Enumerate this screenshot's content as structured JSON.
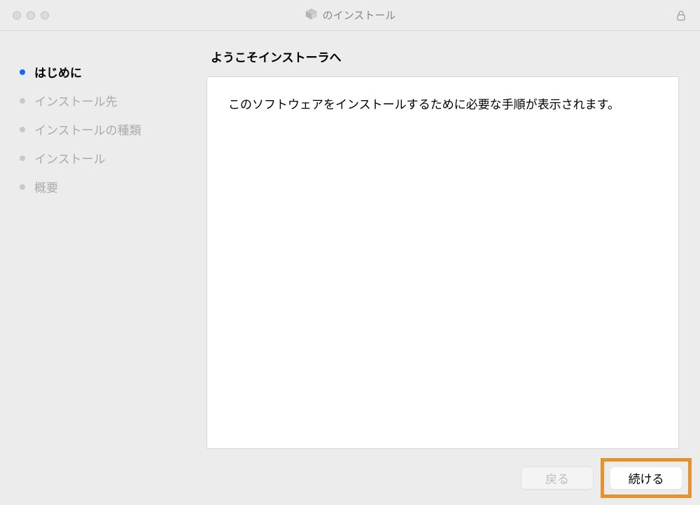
{
  "titlebar": {
    "title": "のインストール"
  },
  "sidebar": {
    "steps": [
      {
        "label": "はじめに",
        "active": true
      },
      {
        "label": "インストール先",
        "active": false
      },
      {
        "label": "インストールの種類",
        "active": false
      },
      {
        "label": "インストール",
        "active": false
      },
      {
        "label": "概要",
        "active": false
      }
    ]
  },
  "main": {
    "heading": "ようこそインストーラへ",
    "body_text": "このソフトウェアをインストールするために必要な手順が表示されます。"
  },
  "footer": {
    "back_label": "戻る",
    "continue_label": "続ける"
  }
}
